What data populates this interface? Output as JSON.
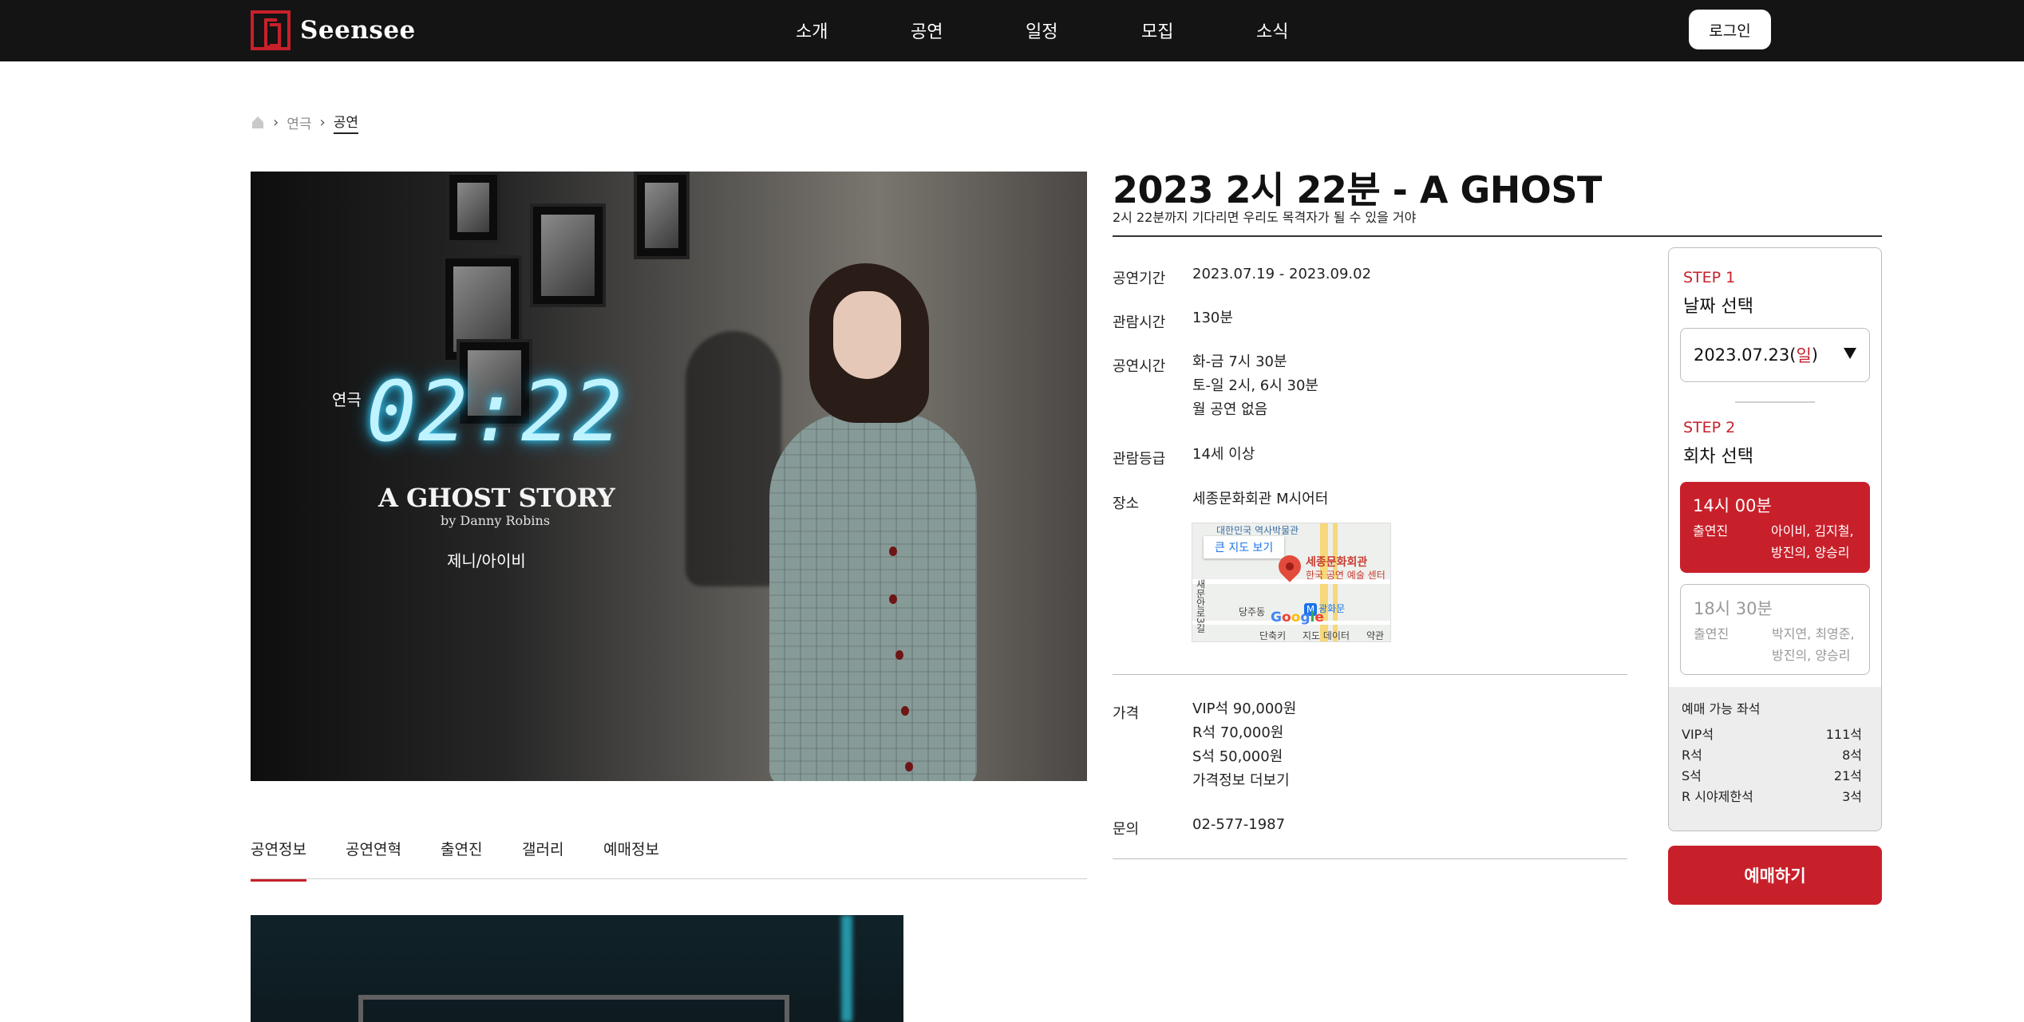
{
  "header": {
    "logo_text": "Seensee",
    "nav": [
      "소개",
      "공연",
      "일정",
      "모집",
      "소식"
    ],
    "login_label": "로그인"
  },
  "breadcrumb": {
    "items": [
      "연극",
      "공연"
    ]
  },
  "poster": {
    "genre": "연극",
    "digits": "02:22",
    "title": "A GHOST STORY",
    "byline": "by Danny Robins",
    "cast": "제니/아이비"
  },
  "tabs": [
    "공연정보",
    "공연연혁",
    "출연진",
    "갤러리",
    "예매정보"
  ],
  "show": {
    "title": "2023 2시 22분 - A GHOST",
    "subtitle": "2시 22분까지 기다리면 우리도 목격자가 될 수 있을 거야",
    "period_label": "공연기간",
    "period": "2023.07.19 - 2023.09.02",
    "runtime_label": "관람시간",
    "runtime": "130분",
    "times_label": "공연시간",
    "times": [
      "화-금 7시 30분",
      "토-일 2시, 6시 30분",
      "월 공연 없음"
    ],
    "rating_label": "관람등급",
    "rating": "14세 이상",
    "venue_label": "장소",
    "venue": "세종문화회관 M시어터",
    "price_label": "가격",
    "prices": [
      "VIP석 90,000원",
      "R석 70,000원",
      "S석 50,000원"
    ],
    "price_more": "가격정보 더보기",
    "contact_label": "문의",
    "contact": "02-577-1987"
  },
  "map": {
    "big_map_button": "큰 지도 보기",
    "place_name": "세종문화회관",
    "place_sub": "한국 공연 예술 센터",
    "museum": "대한민국 역사박물관",
    "station": "광화문",
    "area1": "당주동",
    "road": "새문안로3길",
    "footer": [
      "단축키",
      "지도 데이터",
      "약관"
    ],
    "google": "Google"
  },
  "booking": {
    "step1_label": "STEP 1",
    "step1_title": "날짜 선택",
    "selected_date": "2023.07.23(",
    "selected_weekday": "일",
    "selected_date_close": ")",
    "step2_label": "STEP 2",
    "step2_title": "회차 선택",
    "sessions": [
      {
        "time": "14시 00분",
        "cast_label": "출연진",
        "cast": "아이비, 김지철, 방진의, 양승리",
        "selected": true
      },
      {
        "time": "18시 30분",
        "cast_label": "출연진",
        "cast": "박지연, 최영준, 방진의, 양승리",
        "selected": false
      }
    ],
    "seats_title": "예매 가능 좌석",
    "seats": [
      {
        "type": "VIP석",
        "count": "111석"
      },
      {
        "type": "R석",
        "count": "8석"
      },
      {
        "type": "S석",
        "count": "21석"
      },
      {
        "type": "R 시야제한석",
        "count": "3석"
      }
    ],
    "book_label": "예매하기"
  },
  "colors": {
    "accent": "#c8202b",
    "header_bg": "#141414"
  }
}
